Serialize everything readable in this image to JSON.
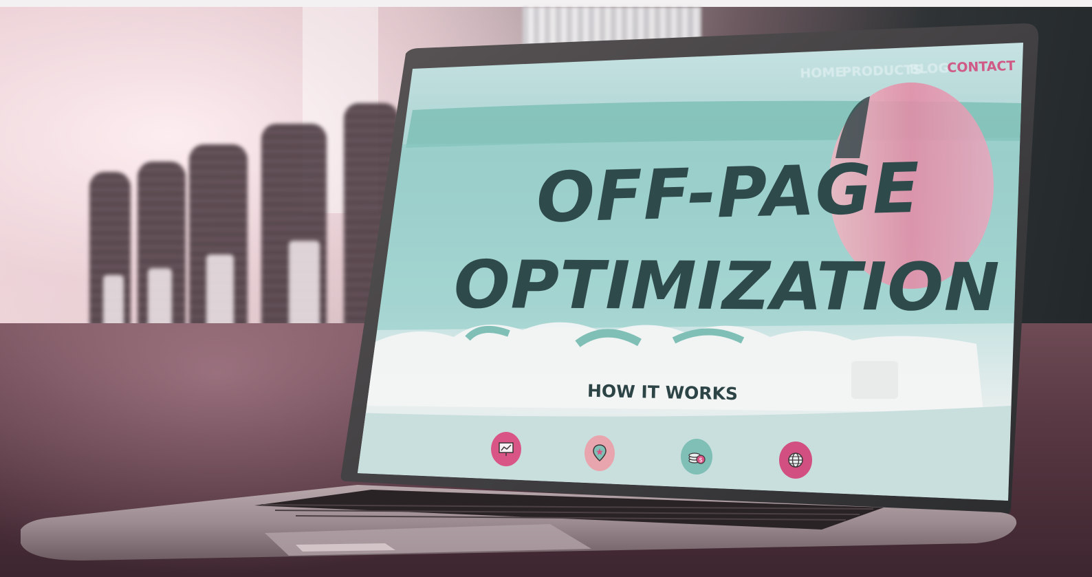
{
  "screen": {
    "nav": {
      "items": [
        {
          "label": "HOME"
        },
        {
          "label": "PRODUCTS"
        },
        {
          "label": "BLOG"
        },
        {
          "label": "CONTACT"
        }
      ]
    },
    "headline": {
      "line1": "OFF-PAGE",
      "line2": "OPTIMIZATION"
    },
    "subhead": "HOW IT WORKS",
    "features": [
      {
        "icon": "presentation-chart-icon",
        "color": "#d95585"
      },
      {
        "icon": "location-pin-icon",
        "color": "#e8a5ae"
      },
      {
        "icon": "coins-dollar-icon",
        "color": "#7fbfb6"
      },
      {
        "icon": "globe-icon",
        "color": "#d24f82"
      }
    ]
  },
  "colors": {
    "accent_pink": "#d05a86",
    "teal": "#7fbfb6",
    "dark_text": "#2f4a4b"
  }
}
